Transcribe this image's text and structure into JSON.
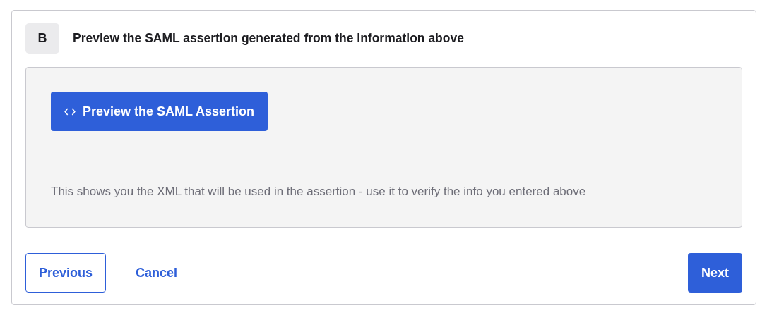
{
  "step": {
    "badge": "B",
    "title": "Preview the SAML assertion generated from the information above"
  },
  "preview": {
    "button": "Preview the SAML Assertion",
    "description": "This shows you the XML that will be used in the assertion - use it to verify the info you entered above"
  },
  "footer": [
    {
      "label": "Previous",
      "kind": "outline"
    },
    {
      "label": "Cancel",
      "kind": "link"
    },
    {
      "label": "Next",
      "kind": "primary"
    }
  ]
}
